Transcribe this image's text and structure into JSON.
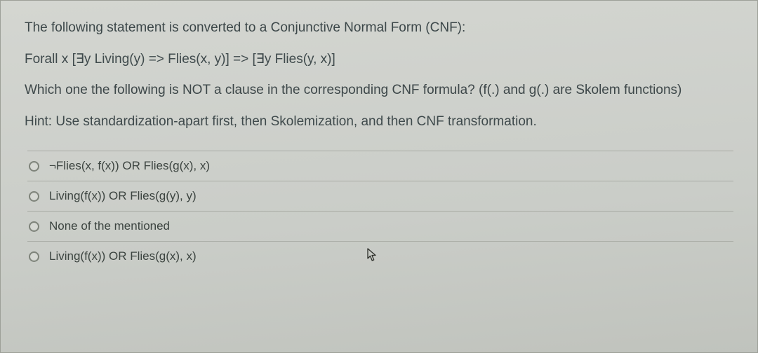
{
  "question": {
    "intro": "The following statement is converted to a Conjunctive Normal Form (CNF):",
    "formula": "Forall x [∃y Living(y) => Flies(x, y)] => [∃y Flies(y, x)]",
    "prompt": "Which one the following is NOT a clause in the corresponding CNF formula?  (f(.) and g(.) are Skolem functions)",
    "hint": "Hint: Use standardization-apart first, then Skolemization, and then CNF transformation."
  },
  "options": [
    {
      "id": "opt-a",
      "label": "¬Flies(x, f(x)) OR Flies(g(x), x)"
    },
    {
      "id": "opt-b",
      "label": "Living(f(x)) OR Flies(g(y), y)"
    },
    {
      "id": "opt-c",
      "label": "None of the mentioned"
    },
    {
      "id": "opt-d",
      "label": "Living(f(x)) OR Flies(g(x), x)"
    }
  ],
  "icons": {
    "cursor": "cursor-pointer-icon"
  }
}
